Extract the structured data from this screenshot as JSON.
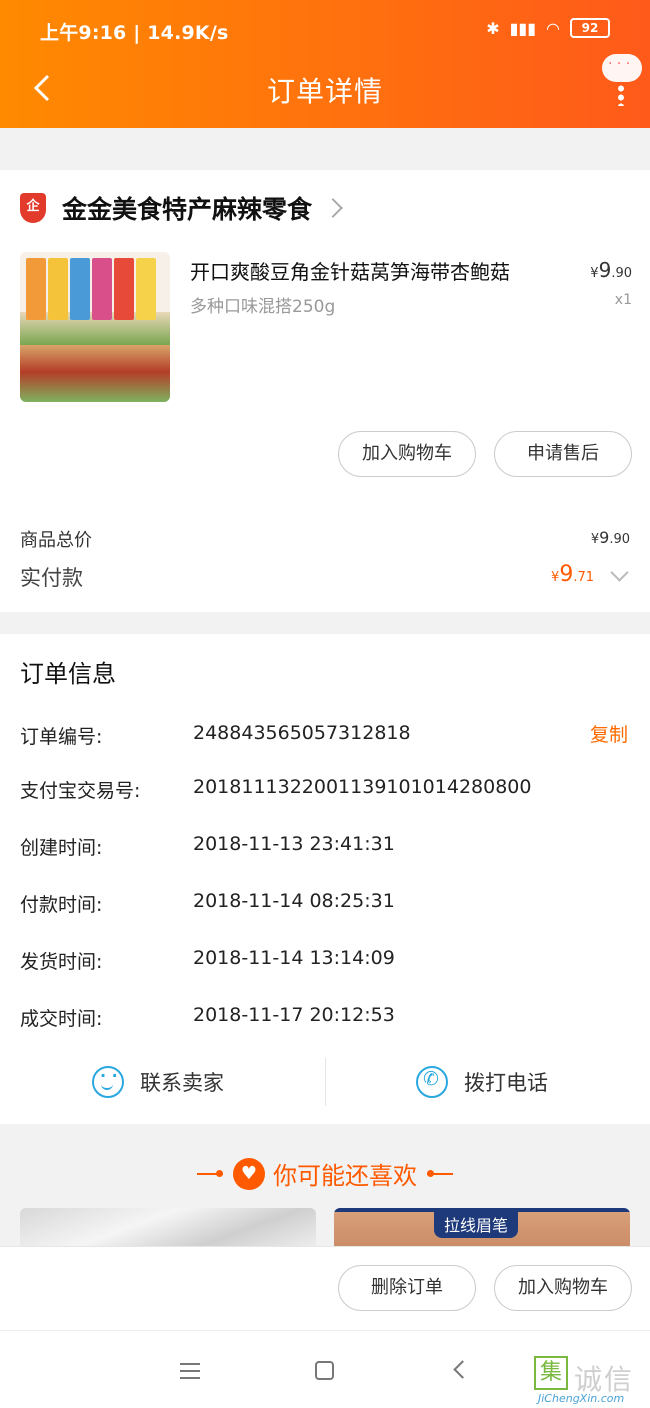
{
  "status_bar": {
    "time_speed": "上午9:16 | 14.9K/s",
    "battery": "92"
  },
  "header": {
    "title": "订单详情"
  },
  "shop": {
    "name": "金金美食特产麻辣零食"
  },
  "product": {
    "name": "开口爽酸豆角金针菇莴笋海带杏鲍菇",
    "spec": "多种口味混搭250g",
    "price_currency": "¥",
    "price_int": "9",
    "price_dec": ".90",
    "qty": "x1"
  },
  "actions": {
    "add_cart": "加入购物车",
    "after_sale": "申请售后"
  },
  "summary": {
    "total_label": "商品总价",
    "total_currency": "¥",
    "total_int": "9",
    "total_dec": ".90",
    "paid_label": "实付款",
    "paid_currency": "¥",
    "paid_int": "9",
    "paid_dec": ".71"
  },
  "order_info": {
    "title": "订单信息",
    "copy_label": "复制",
    "rows": [
      {
        "label": "订单编号:",
        "value": "248843565057312818"
      },
      {
        "label": "支付宝交易号:",
        "value": "2018111322001139101014280800"
      },
      {
        "label": "创建时间:",
        "value": "2018-11-13 23:41:31"
      },
      {
        "label": "付款时间:",
        "value": "2018-11-14 08:25:31"
      },
      {
        "label": "发货时间:",
        "value": "2018-11-14 13:14:09"
      },
      {
        "label": "成交时间:",
        "value": "2018-11-17 20:12:53"
      }
    ],
    "contact_seller": "联系卖家",
    "call_phone": "拨打电话"
  },
  "recommend": {
    "title": "你可能还喜欢",
    "tag": "拉线眉笔"
  },
  "bottom": {
    "delete_order": "删除订单",
    "add_cart": "加入购物车"
  },
  "watermark": {
    "badge": "集",
    "text": "诚信",
    "sub": "JiChengXin.com"
  },
  "colors": {
    "accent": "#ff5a00",
    "header_start": "#ff8a00",
    "icon_blue": "#29a8e0"
  }
}
